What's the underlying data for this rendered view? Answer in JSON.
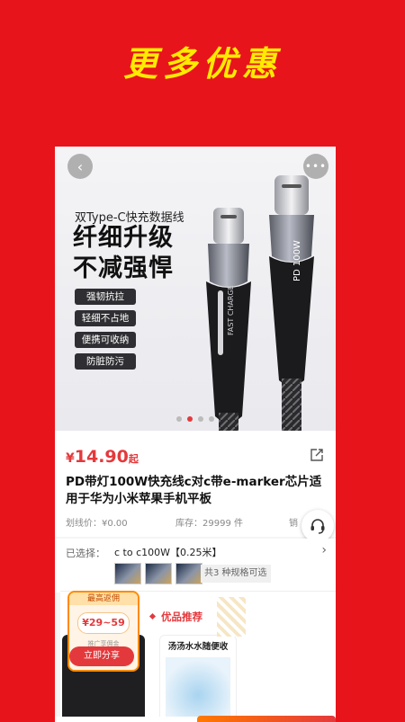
{
  "banner": {
    "title": "更多优惠"
  },
  "hero": {
    "subtitle": "双Type-C快充数据线",
    "headline_1": "纤细升级",
    "headline_2": "不减强悍",
    "tags": [
      "强韧抗拉",
      "轻细不占地",
      "便携可收纳",
      "防脏防污"
    ],
    "cable_print_1": "FAST CHARGE",
    "cable_print_2": "PD 100W",
    "slide_count": 4,
    "active_slide": 2
  },
  "product": {
    "price_symbol": "¥",
    "price": "14.90",
    "price_suffix": "起",
    "title": "PD带灯100W快充线c对c带e-marker芯片适用于华为小米苹果手机平板",
    "original_price": "划线价：¥0.00",
    "stock": "库存：29999 件",
    "sales": "销"
  },
  "spec": {
    "label": "已选择：",
    "value": "c to c100W【0.25米】",
    "count_text": "共3 种规格可选"
  },
  "commission": {
    "top": "最高返佣",
    "range": "¥29~59",
    "note": "推广享佣金",
    "share_button": "立即分享"
  },
  "recommend": {
    "title": "优品推荐",
    "card2_title": "汤汤水水随便收"
  },
  "colors": {
    "background": "#e8141b",
    "banner_text": "#ffeb00",
    "accent": "#e4393c"
  }
}
